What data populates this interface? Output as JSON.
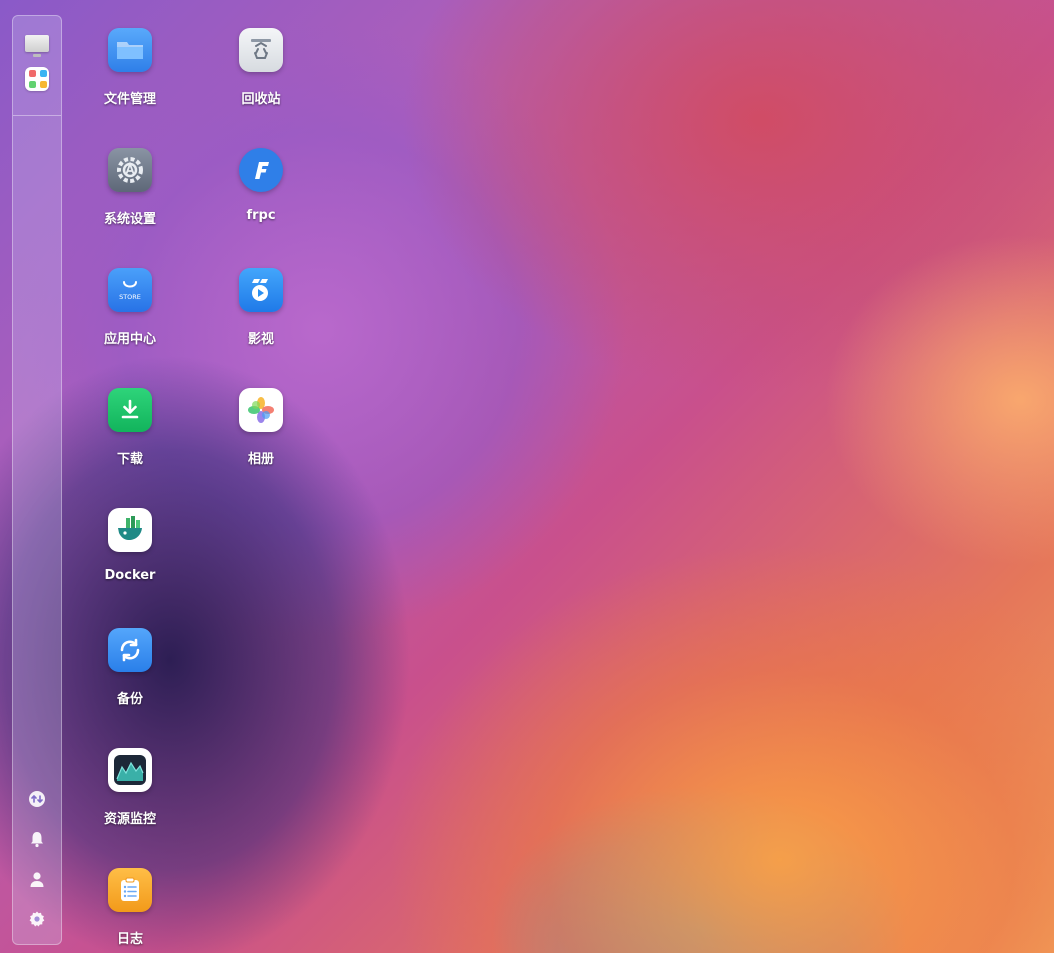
{
  "sidebar": {
    "top": [
      {
        "name": "desktop",
        "icon": "monitor-icon"
      },
      {
        "name": "app-launcher",
        "icon": "app-grid-icon"
      }
    ],
    "bottom": [
      {
        "name": "transfer",
        "icon": "transfer-icon"
      },
      {
        "name": "notifications",
        "icon": "bell-icon"
      },
      {
        "name": "user",
        "icon": "user-icon"
      },
      {
        "name": "settings",
        "icon": "gear-icon"
      }
    ]
  },
  "apps": [
    {
      "label": "文件管理",
      "icon": "folder-icon",
      "color": "#3d8ff2"
    },
    {
      "label": "回收站",
      "icon": "recycle-bin-icon",
      "color": "#e6e9ec"
    },
    {
      "label": "系统设置",
      "icon": "settings-app-icon",
      "color": "#7b8596"
    },
    {
      "label": "frpc",
      "icon": "frpc-icon",
      "color": "#2f7fe8"
    },
    {
      "label": "应用中心",
      "icon": "store-icon",
      "color": "#2f86f0"
    },
    {
      "label": "影视",
      "icon": "video-icon",
      "color": "#2b8ff0"
    },
    {
      "label": "下载",
      "icon": "download-icon",
      "color": "#20c36a"
    },
    {
      "label": "相册",
      "icon": "photos-icon",
      "color": "#ffffff"
    },
    {
      "label": "Docker",
      "icon": "docker-icon",
      "color": "#ffffff"
    },
    {
      "label": "备份",
      "icon": "backup-icon",
      "color": "#3e94f2"
    },
    {
      "label": "资源监控",
      "icon": "resource-monitor-icon",
      "color": "#1e2a3a"
    },
    {
      "label": "日志",
      "icon": "log-icon",
      "color": "#f7a82a"
    }
  ],
  "store_icon_text": "STORE"
}
